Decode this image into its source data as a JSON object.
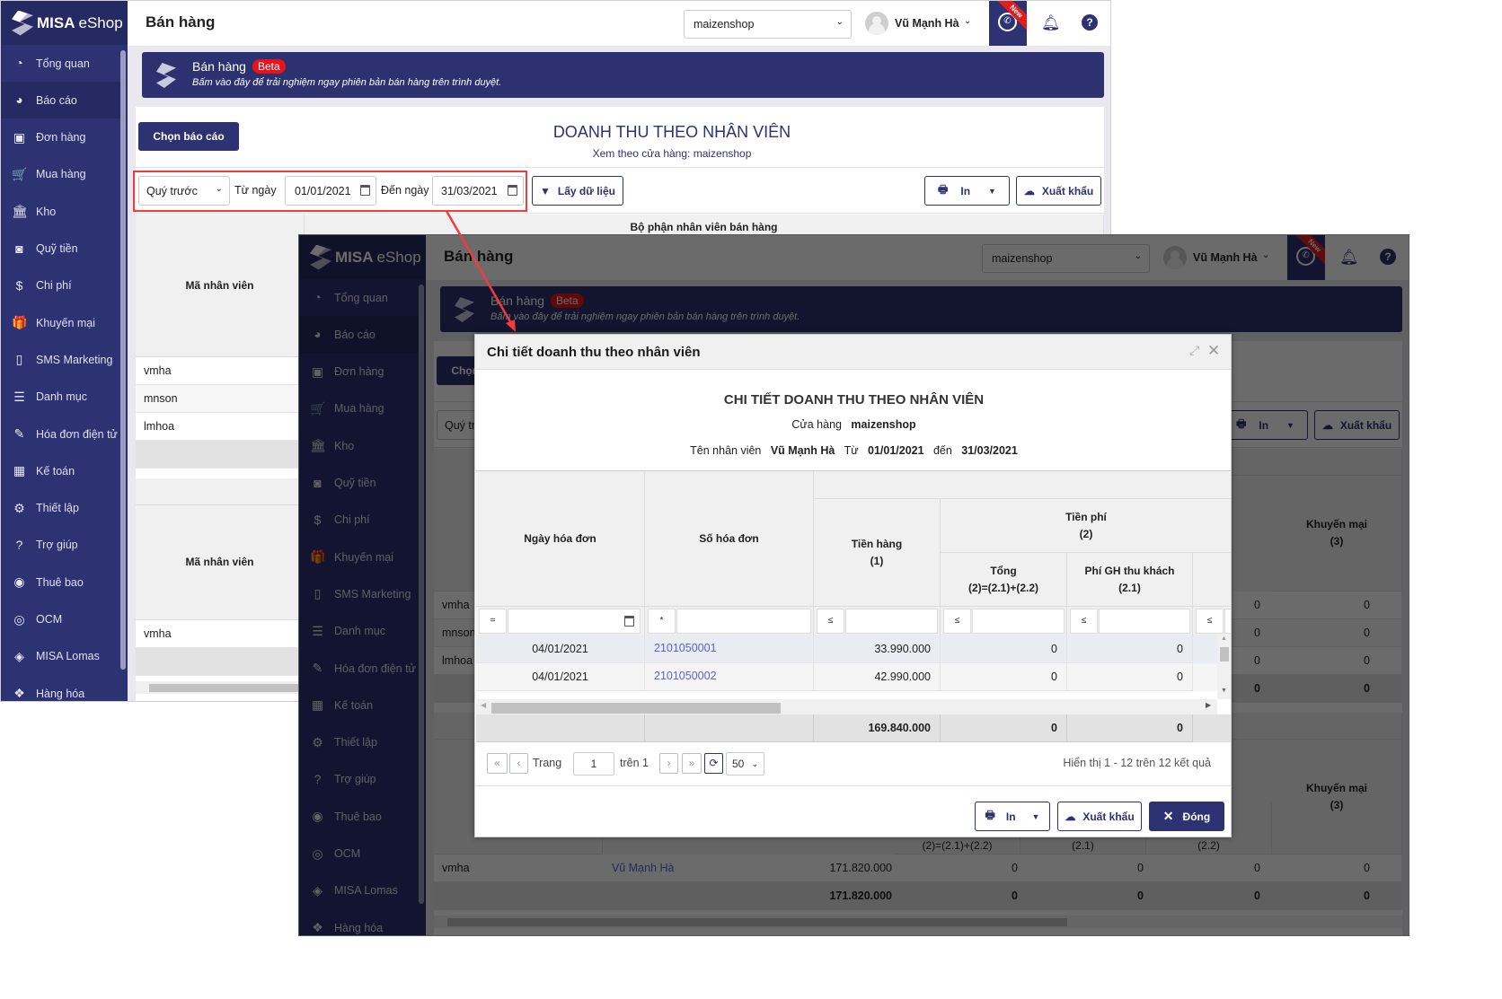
{
  "colors": {
    "brand_navy": "#2d3272",
    "beta_red": "#e8131b",
    "highlight_red": "#f13c3c",
    "link_blue": "#5b62d6"
  },
  "app": {
    "logo": {
      "brand": "MISA",
      "product": "eShop"
    },
    "sidebar": {
      "items": [
        {
          "label": "Tổng quan",
          "icon": "dashboard-icon",
          "glyph": "◔"
        },
        {
          "label": "Báo cáo",
          "icon": "pie-chart-icon",
          "glyph": "◕",
          "active": true
        },
        {
          "label": "Đơn hàng",
          "icon": "order-icon",
          "glyph": "▣"
        },
        {
          "label": "Mua hàng",
          "icon": "cart-icon",
          "glyph": "🛒"
        },
        {
          "label": "Kho",
          "icon": "warehouse-icon",
          "glyph": "🏛"
        },
        {
          "label": "Quỹ tiền",
          "icon": "safe-icon",
          "glyph": "◙"
        },
        {
          "label": "Chi phí",
          "icon": "money-bag-icon",
          "glyph": "$"
        },
        {
          "label": "Khuyến mại",
          "icon": "gift-icon",
          "glyph": "🎁"
        },
        {
          "label": "SMS Marketing",
          "icon": "phone-icon",
          "glyph": "▯"
        },
        {
          "label": "Danh mục",
          "icon": "list-icon",
          "glyph": "☰"
        },
        {
          "label": "Hóa đơn điện tử",
          "icon": "invoice-icon",
          "glyph": "✎"
        },
        {
          "label": "Kế toán",
          "icon": "calculator-icon",
          "glyph": "▦"
        },
        {
          "label": "Thiết lập",
          "icon": "gear-icon",
          "glyph": "⚙"
        },
        {
          "label": "Trợ giúp",
          "icon": "help-icon",
          "glyph": "?"
        },
        {
          "label": "Thuê bao",
          "icon": "user-icon",
          "glyph": "◉"
        },
        {
          "label": "OCM",
          "icon": "ocm-icon",
          "glyph": "◎"
        },
        {
          "label": "MISA Lomas",
          "icon": "lomas-icon",
          "glyph": "◈"
        },
        {
          "label": "Hàng hóa",
          "icon": "goods-icon",
          "glyph": "❖"
        }
      ]
    },
    "header": {
      "title": "Bán hàng",
      "store": "maizenshop",
      "user": "Vũ Mạnh Hà",
      "new_badge": "New"
    },
    "banner": {
      "title": "Bán hàng",
      "badge": "Beta",
      "subtitle": "Bấm vào đây để trải nghiệm ngay phiên bản bán hàng trên trình duyệt."
    },
    "report": {
      "choose_button": "Chọn báo cáo",
      "title": "DOANH THU THEO NHÂN VIÊN",
      "subtitle": "Xem theo cửa hàng: maizenshop",
      "period": "Quý trước",
      "from_label": "Từ ngày",
      "from_date": "01/01/2021",
      "to_label": "Đến ngày",
      "to_date": "31/03/2021",
      "fetch_button": "Lấy dữ liệu",
      "print_button": "In",
      "export_button": "Xuất khẩu",
      "group_header": "Bộ phận nhân viên bán hàng",
      "col_code": "Mã nhân viên",
      "col_promo": "Khuyến mại\n(3)",
      "sub_total_formula": "(2)=(2.1)+(2.2)",
      "sub_21": "(2.1)",
      "sub_22": "(2.2)",
      "table1_rows": [
        {
          "code": "vmha",
          "c6": "0",
          "c7": "0"
        },
        {
          "code": "mnson",
          "c6": "0",
          "c7": "0"
        },
        {
          "code": "lmhoa",
          "c6": "0",
          "c7": "0"
        }
      ],
      "table1_total": {
        "c6": "0",
        "c7": "0"
      },
      "table2_rows": [
        {
          "code": "vmha",
          "name": "Vũ Mạnh Hà",
          "revenue": "171.820.000",
          "c4": "0",
          "c5": "0",
          "c6": "0",
          "c7": "0"
        }
      ],
      "table2_total": {
        "revenue": "171.820.000",
        "c4": "0",
        "c5": "0",
        "c6": "0",
        "c7": "0"
      }
    }
  },
  "modal": {
    "title": "Chi tiết doanh thu theo nhân viên",
    "heading": "CHI TIẾT DOANH THU THEO NHÂN VIÊN",
    "store_label": "Cửa hàng",
    "store_value": "maizenshop",
    "employee_label": "Tên nhân viên",
    "employee_value": "Vũ Mạnh Hà",
    "from_label": "Từ",
    "from_value": "01/01/2021",
    "to_label": "đến",
    "to_value": "31/03/2021",
    "columns": {
      "date": "Ngày hóa đơn",
      "invoice": "Số hóa đơn",
      "goods": "Tiền hàng\n(1)",
      "fees": "Tiền phí\n(2)",
      "fee_total": "Tổng\n(2)=(2.1)+(2.2)",
      "fee_delivery": "Phí GH thu khách\n(2.1)"
    },
    "filters": {
      "date_op": "=",
      "invoice_op": "*",
      "goods_op": "≤",
      "fee_total_op": "≤",
      "fee_delivery_op": "≤",
      "next_op": "≤"
    },
    "rows": [
      {
        "date": "04/01/2021",
        "invoice": "2101050001",
        "goods": "33.990.000",
        "fee_total": "0",
        "fee_delivery": "0"
      },
      {
        "date": "04/01/2021",
        "invoice": "2101050002",
        "goods": "42.990.000",
        "fee_total": "0",
        "fee_delivery": "0"
      }
    ],
    "totals": {
      "goods": "169.840.000",
      "fee_total": "0",
      "fee_delivery": "0"
    },
    "pagination": {
      "page_label": "Trang",
      "page": "1",
      "of_label": "trên 1",
      "page_size": "50",
      "summary": "Hiển thị 1 - 12 trên 12 kết quả"
    },
    "buttons": {
      "print": "In",
      "export": "Xuất khẩu",
      "close": "Đóng"
    }
  }
}
